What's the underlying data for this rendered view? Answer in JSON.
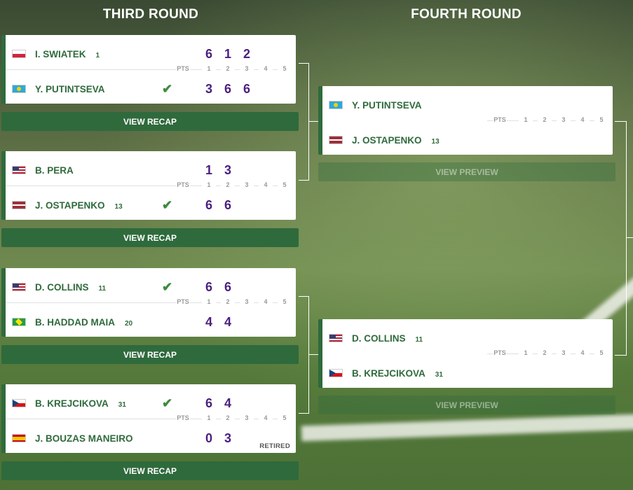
{
  "rounds": {
    "third": "THIRD ROUND",
    "fourth": "FOURTH ROUND"
  },
  "pts_labels": {
    "pts": "PTS",
    "s1": "1",
    "s2": "2",
    "s3": "3",
    "s4": "4",
    "s5": "5"
  },
  "third_round": [
    {
      "p1": {
        "name": "I. SWIATEK",
        "seed": "1",
        "flag": "poland-flag",
        "scores": [
          "6",
          "1",
          "2"
        ],
        "winner": false
      },
      "p2": {
        "name": "Y. PUTINTSEVA",
        "seed": "",
        "flag": "kazakhstan-flag",
        "scores": [
          "3",
          "6",
          "6"
        ],
        "winner": true
      },
      "button": "VIEW RECAP"
    },
    {
      "p1": {
        "name": "B. PERA",
        "seed": "",
        "flag": "usa-flag",
        "scores": [
          "1",
          "3"
        ],
        "winner": false
      },
      "p2": {
        "name": "J. OSTAPENKO",
        "seed": "13",
        "flag": "latvia-flag",
        "scores": [
          "6",
          "6"
        ],
        "winner": true
      },
      "button": "VIEW RECAP"
    },
    {
      "p1": {
        "name": "D. COLLINS",
        "seed": "11",
        "flag": "usa-flag",
        "scores": [
          "6",
          "6"
        ],
        "winner": true
      },
      "p2": {
        "name": "B. HADDAD MAIA",
        "seed": "20",
        "flag": "brazil-flag",
        "scores": [
          "4",
          "4"
        ],
        "winner": false
      },
      "button": "VIEW RECAP"
    },
    {
      "p1": {
        "name": "B. KREJCIKOVA",
        "seed": "31",
        "flag": "czech-flag",
        "scores": [
          "6",
          "4"
        ],
        "winner": true
      },
      "p2": {
        "name": "J. BOUZAS MANEIRO",
        "seed": "",
        "flag": "spain-flag",
        "scores": [
          "0",
          "3"
        ],
        "winner": false
      },
      "status": "RETIRED",
      "button": "VIEW RECAP"
    }
  ],
  "fourth_round": [
    {
      "p1": {
        "name": "Y. PUTINTSEVA",
        "seed": "",
        "flag": "kazakhstan-flag"
      },
      "p2": {
        "name": "J. OSTAPENKO",
        "seed": "13",
        "flag": "latvia-flag"
      },
      "button": "VIEW PREVIEW"
    },
    {
      "p1": {
        "name": "D. COLLINS",
        "seed": "11",
        "flag": "usa-flag"
      },
      "p2": {
        "name": "B. KREJCIKOVA",
        "seed": "31",
        "flag": "czech-flag"
      },
      "button": "VIEW PREVIEW"
    }
  ],
  "colors": {
    "accent": "#2f6a3c",
    "score": "#4b2080",
    "check": "#3d8b3d"
  }
}
